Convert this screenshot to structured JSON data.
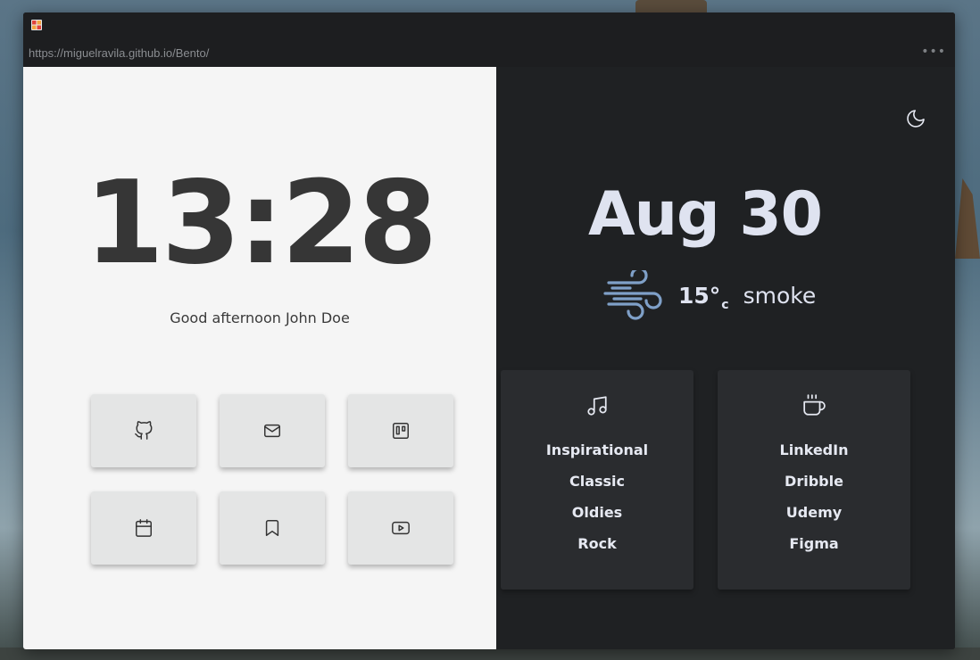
{
  "browser": {
    "url": "https://miguelravila.github.io/Bento/",
    "menu_icon": "more-horizontal-icon"
  },
  "clock": {
    "time": "13:28"
  },
  "greeting": "Good afternoon John Doe",
  "quick_links": [
    {
      "name": "github",
      "icon": "github-icon"
    },
    {
      "name": "mail",
      "icon": "mail-icon"
    },
    {
      "name": "trello",
      "icon": "trello-icon"
    },
    {
      "name": "calendar",
      "icon": "calendar-icon"
    },
    {
      "name": "bookmark",
      "icon": "bookmark-icon"
    },
    {
      "name": "youtube",
      "icon": "youtube-icon"
    }
  ],
  "date": "Aug 30",
  "weather": {
    "icon": "wind-icon",
    "temperature": "15°",
    "unit": "c",
    "condition": "smoke"
  },
  "lists": [
    {
      "icon": "music-icon",
      "items": [
        "Inspirational",
        "Classic",
        "Oldies",
        "Rock"
      ]
    },
    {
      "icon": "coffee-icon",
      "items": [
        "LinkedIn",
        "Dribble",
        "Udemy",
        "Figma"
      ]
    }
  ],
  "colors": {
    "left_panel": "#f5f5f5",
    "right_panel": "#1f2123",
    "card_dark": "#2a2c2f",
    "accent_weather": "#7fa0c8",
    "text_light": "#dfe3f0",
    "text_dark": "#363636"
  },
  "theme_toggle_icon": "moon-icon"
}
